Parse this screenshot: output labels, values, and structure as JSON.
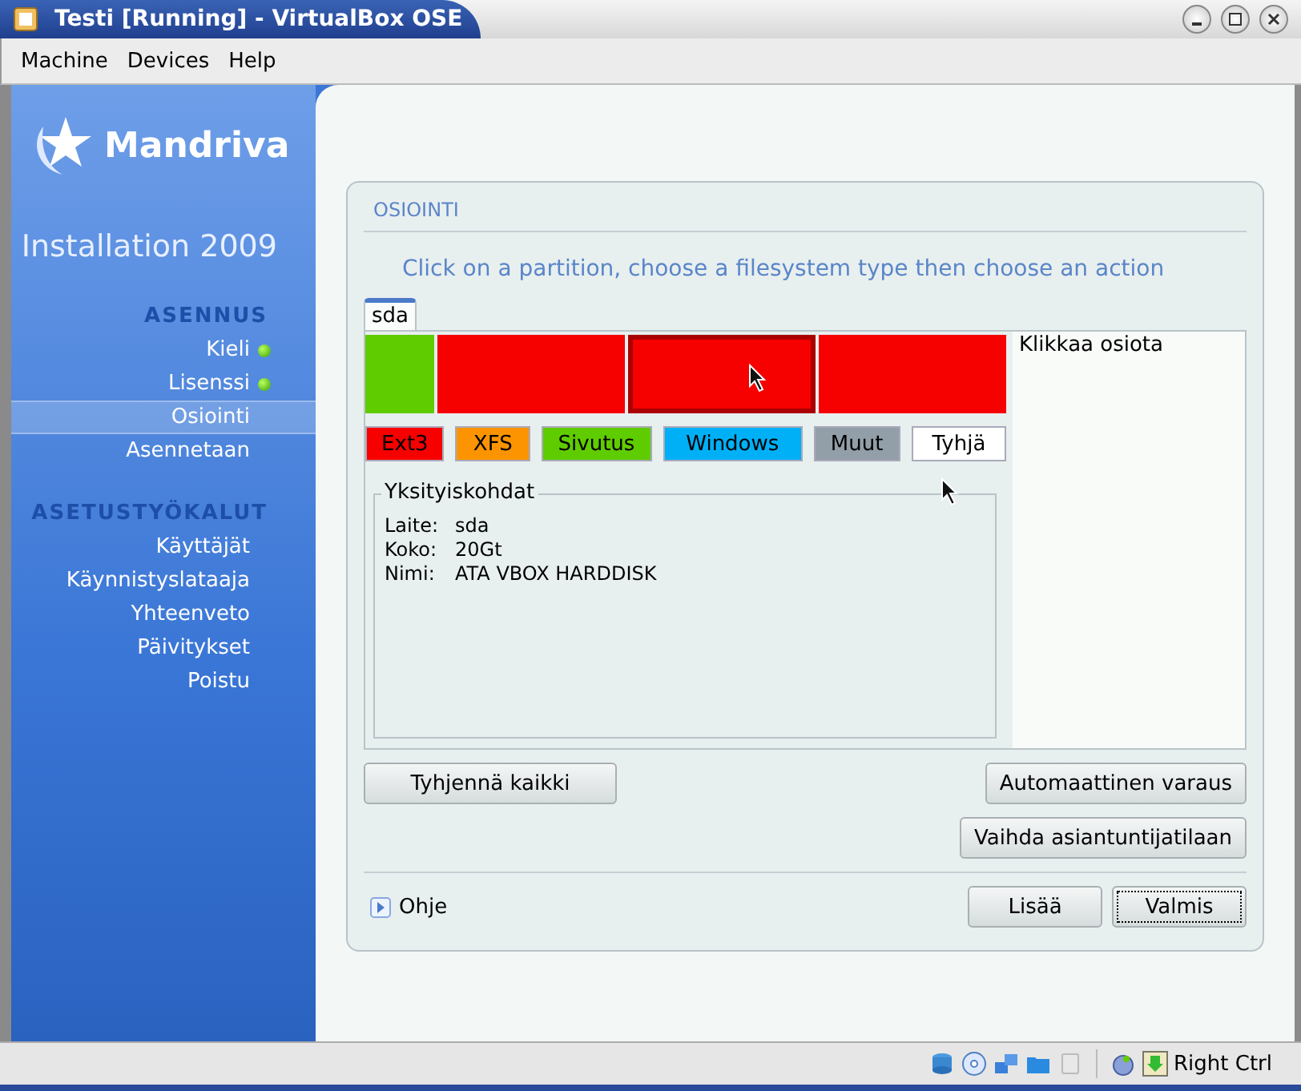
{
  "window": {
    "title": "Testi [Running] - VirtualBox OSE"
  },
  "menu": [
    "Machine",
    "Devices",
    "Help"
  ],
  "sidebar": {
    "logo": "Mandriva",
    "subtitle": "Installation 2009",
    "sections": [
      {
        "heading": "ASENNUS",
        "items": [
          {
            "label": "Kieli",
            "done": true,
            "selected": false
          },
          {
            "label": "Lisenssi",
            "done": true,
            "selected": false
          },
          {
            "label": "Osiointi",
            "done": false,
            "selected": true
          },
          {
            "label": "Asennetaan",
            "done": false,
            "selected": false
          }
        ]
      },
      {
        "heading": "ASETUSTYÖKALUT",
        "items": [
          {
            "label": "Käyttäjät",
            "done": false,
            "selected": false
          },
          {
            "label": "Käynnistyslataaja",
            "done": false,
            "selected": false
          },
          {
            "label": "Yhteenveto",
            "done": false,
            "selected": false
          },
          {
            "label": "Päivitykset",
            "done": false,
            "selected": false
          },
          {
            "label": "Poistu",
            "done": false,
            "selected": false
          }
        ]
      }
    ]
  },
  "panel": {
    "title": "OSIOINTI",
    "instruction": "Click on a partition, choose a filesystem type then choose an action",
    "tabs": [
      {
        "label": "sda",
        "selected": true
      }
    ],
    "partitions": [
      {
        "kind": "swap",
        "color": "#5fcc00",
        "selected": false
      },
      {
        "kind": "ext3",
        "color": "#f70000",
        "selected": false
      },
      {
        "kind": "ext3",
        "color": "#f70000",
        "selected": true
      },
      {
        "kind": "ext3",
        "color": "#f70000",
        "selected": false
      }
    ],
    "legend": [
      {
        "label": "Ext3",
        "color": "#f70000"
      },
      {
        "label": "XFS",
        "color": "#fb9400"
      },
      {
        "label": "Sivutus",
        "color": "#5fcc00"
      },
      {
        "label": "Windows",
        "color": "#00b0f6"
      },
      {
        "label": "Muut",
        "color": "#929ea8"
      },
      {
        "label": "Tyhjä",
        "color": "#ffffff"
      }
    ],
    "info_hint": "Klikkaa osiota",
    "details": {
      "title": "Yksityiskohdat",
      "rows": [
        {
          "label": "Laite:",
          "value": "sda"
        },
        {
          "label": "Koko:",
          "value": "20Gt"
        },
        {
          "label": "Nimi:",
          "value": "ATA VBOX HARDDISK"
        }
      ]
    },
    "left_button": "Tyhjennä kaikki",
    "right_buttons": [
      "Automaattinen varaus",
      "Vaihda asiantuntijatilaan"
    ],
    "help": "Ohje",
    "footer_buttons": [
      {
        "label": "Lisää",
        "focused": false
      },
      {
        "label": "Valmis",
        "focused": true
      }
    ]
  },
  "status_bar": {
    "host_key": "Right Ctrl"
  }
}
